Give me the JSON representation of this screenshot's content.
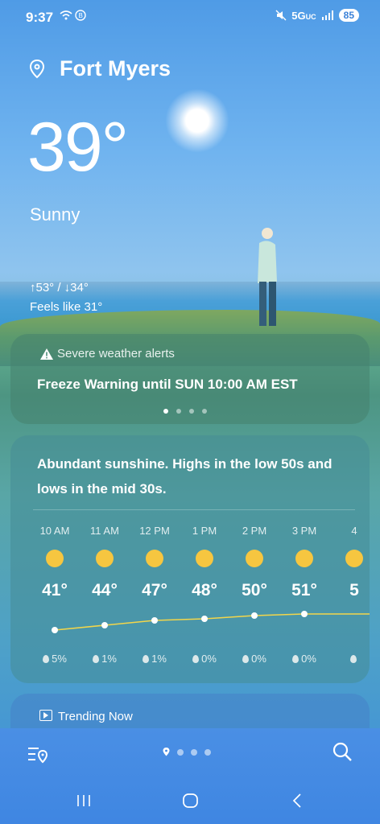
{
  "status_bar": {
    "time": "9:37",
    "network": "5G",
    "network_sub": "UC",
    "battery": "85"
  },
  "location": {
    "name": "Fort Myers"
  },
  "current": {
    "temperature": "39°",
    "condition": "Sunny",
    "high_low": "↑53° / ↓34°",
    "feels_like": "Feels like 31°"
  },
  "alert": {
    "title": "Severe weather alerts",
    "text": "Freeze Warning until SUN 10:00 AM EST",
    "pages": 4,
    "active_page": 0
  },
  "forecast": {
    "summary": "Abundant sunshine. Highs in the low 50s and lows in the mid 30s.",
    "hours": [
      {
        "time": "10 AM",
        "temp": "41°",
        "precip": "5%",
        "icon": "sun-icon"
      },
      {
        "time": "11 AM",
        "temp": "44°",
        "precip": "1%",
        "icon": "sun-icon"
      },
      {
        "time": "12 PM",
        "temp": "47°",
        "precip": "1%",
        "icon": "sun-icon"
      },
      {
        "time": "1 PM",
        "temp": "48°",
        "precip": "0%",
        "icon": "sun-icon"
      },
      {
        "time": "2 PM",
        "temp": "50°",
        "precip": "0%",
        "icon": "sun-icon"
      },
      {
        "time": "3 PM",
        "temp": "51°",
        "precip": "0%",
        "icon": "sun-icon"
      },
      {
        "time": "4",
        "temp": "5",
        "precip": "",
        "icon": "sun-icon"
      }
    ]
  },
  "trending": {
    "label": "Trending Now"
  },
  "bottom_bar": {
    "pages": 4,
    "active_page": 0
  },
  "colors": {
    "sun": "#f6c640",
    "graph_line": "#f3d64a"
  }
}
